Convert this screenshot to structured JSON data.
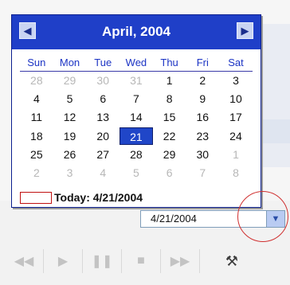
{
  "calendar": {
    "title": "April, 2004",
    "prev_icon": "left-arrow-icon",
    "next_icon": "right-arrow-icon",
    "weekdays": [
      "Sun",
      "Mon",
      "Tue",
      "Wed",
      "Thu",
      "Fri",
      "Sat"
    ],
    "weeks": [
      [
        "28",
        "29",
        "30",
        "31",
        "1",
        "2",
        "3"
      ],
      [
        "4",
        "5",
        "6",
        "7",
        "8",
        "9",
        "10"
      ],
      [
        "11",
        "12",
        "13",
        "14",
        "15",
        "16",
        "17"
      ],
      [
        "18",
        "19",
        "20",
        "21",
        "22",
        "23",
        "24"
      ],
      [
        "25",
        "26",
        "27",
        "28",
        "29",
        "30",
        "1"
      ],
      [
        "2",
        "3",
        "4",
        "5",
        "6",
        "7",
        "8"
      ]
    ],
    "selected": "21",
    "today_label": "Today: 4/21/2004"
  },
  "date_picker": {
    "value": "4/21/2004",
    "dropdown_icon": "chevron-down-icon"
  },
  "toolbar": {
    "buttons": [
      "rewind-icon",
      "play-icon",
      "pause-icon",
      "stop-icon",
      "fast-forward-icon",
      "tools-icon"
    ]
  },
  "colors": {
    "header": "#1f3fc8",
    "selected": "#2046c8",
    "highlight_ring": "#d03030"
  }
}
